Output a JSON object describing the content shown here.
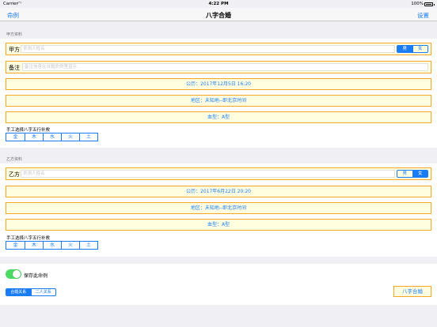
{
  "status_bar": {
    "carrier": "Carrier",
    "time": "4:22 PM",
    "battery": "100%",
    "battery_level": 1.0
  },
  "nav": {
    "left": "命例",
    "title": "八字合婚",
    "right": "设置"
  },
  "party_a": {
    "section_title": "甲方资料",
    "name_label": "甲方",
    "name_placeholder": "求测人姓名",
    "gender": [
      "男",
      "女"
    ],
    "selected_gender": "男",
    "note_label": "备注",
    "note_placeholder": "备注信息在合婚命例里显示",
    "calendar": "公历：2017年12月5日 16:20",
    "region": "地区：未知地--即北京时间",
    "blood": "血型：A型",
    "manual_label": "手工选择八字五行补救",
    "elements": [
      "金",
      "木",
      "水",
      "火",
      "土"
    ]
  },
  "party_b": {
    "section_title": "乙方资料",
    "name_label": "乙方",
    "name_placeholder": "求测人姓名",
    "gender": [
      "男",
      "女"
    ],
    "selected_gender": "女",
    "calendar": "公历：2017年6月22日 20:20",
    "region": "地区：未知地--即北京时间",
    "blood": "血型：A型",
    "manual_label": "手工选择八字五行补救",
    "elements": [
      "金",
      "木",
      "水",
      "火",
      "土"
    ]
  },
  "footer": {
    "save_label": "保存此命例",
    "save_on": true,
    "relations": [
      "合婚关系",
      "二人关系"
    ],
    "selected_relation": "合婚关系",
    "match_button": "八字合婚"
  }
}
